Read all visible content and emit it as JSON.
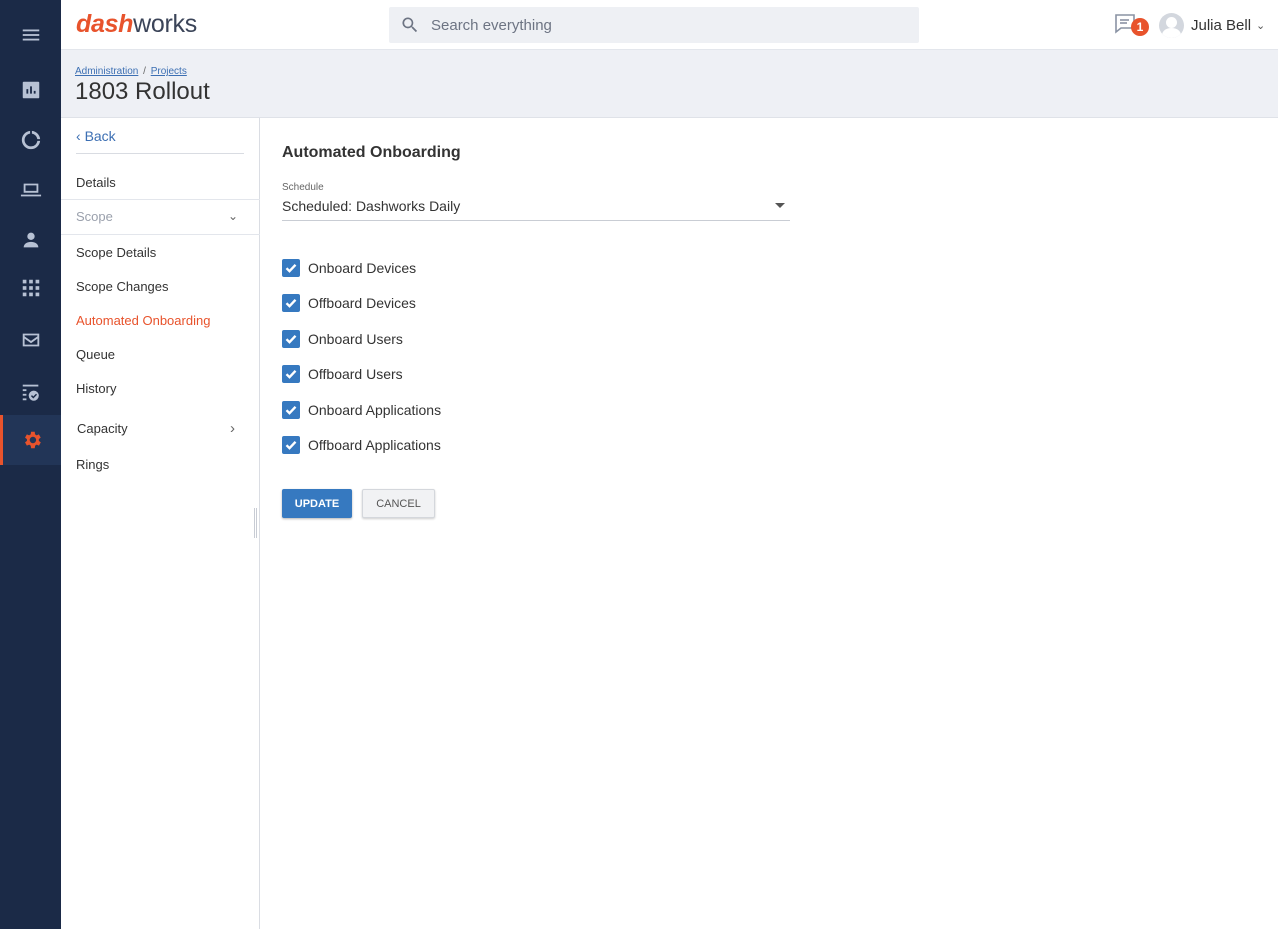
{
  "app": {
    "logo_dash": "dash",
    "logo_works": "works"
  },
  "search": {
    "placeholder": "Search everything"
  },
  "notifications": {
    "count": "1"
  },
  "user": {
    "name": "Julia Bell"
  },
  "breadcrumb": {
    "item1": "Administration",
    "separator": "/",
    "item2": "Projects"
  },
  "page": {
    "title": "1803 Rollout"
  },
  "rail": {
    "icons": [
      "menu-icon",
      "dashboard-icon",
      "circle-progress-icon",
      "devices-icon",
      "users-icon",
      "apps-grid-icon",
      "mail-icon",
      "tasks-icon",
      "settings-icon"
    ]
  },
  "sidenav": {
    "back": "Back",
    "details": "Details",
    "scope": "Scope",
    "scope_details": "Scope Details",
    "scope_changes": "Scope Changes",
    "automated_onboarding": "Automated Onboarding",
    "queue": "Queue",
    "history": "History",
    "capacity": "Capacity",
    "rings": "Rings"
  },
  "main": {
    "title": "Automated Onboarding",
    "schedule_label": "Schedule",
    "schedule_value": "Scheduled: Dashworks Daily",
    "checkboxes": [
      {
        "label": "Onboard Devices",
        "checked": true
      },
      {
        "label": "Offboard Devices",
        "checked": true
      },
      {
        "label": "Onboard Users",
        "checked": true
      },
      {
        "label": "Offboard Users",
        "checked": true
      },
      {
        "label": "Onboard Applications",
        "checked": true
      },
      {
        "label": "Offboard Applications",
        "checked": true
      }
    ],
    "update_label": "UPDATE",
    "cancel_label": "CANCEL"
  },
  "colors": {
    "accent": "#e8532c",
    "primary": "#3679c0",
    "rail": "#1b2a47"
  }
}
